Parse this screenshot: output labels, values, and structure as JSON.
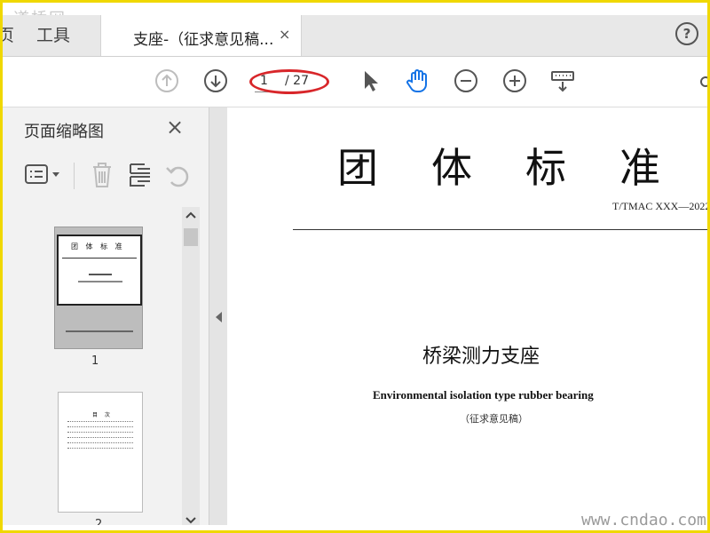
{
  "watermark_top": "道桥网",
  "watermark_bottom": "www.cndao.com",
  "tabbar": {
    "menu_home": "页",
    "menu_tools": "工具",
    "doc_tab_title": "支座-（征求意见稿...",
    "close_glyph": "×",
    "help_glyph": "?"
  },
  "toolbar": {
    "page_current": "1",
    "page_total": "/ 27",
    "icons": [
      "prev-page-icon",
      "next-page-icon",
      "select-cursor-icon",
      "hand-tool-icon",
      "zoom-out-icon",
      "zoom-in-icon",
      "keyboard-icon"
    ],
    "accent_blue": "#1473e6",
    "annotation_color": "#d8262a"
  },
  "left_panel": {
    "title": "页面缩略图",
    "close_glyph": "×",
    "tools": [
      "options-icon",
      "delete-icon",
      "extract-icon",
      "rotate-icon"
    ],
    "thumbnails": [
      {
        "label": "1",
        "heading": "团 体 标 准"
      },
      {
        "label": "2",
        "heading": "目 次"
      }
    ]
  },
  "document": {
    "heading": "团体标准",
    "code": "T/TMAC XXX—2022",
    "title_cn": "桥梁测力支座",
    "title_en": "Environmental isolation type rubber bearing",
    "subtitle": "（征求意见稿）"
  }
}
